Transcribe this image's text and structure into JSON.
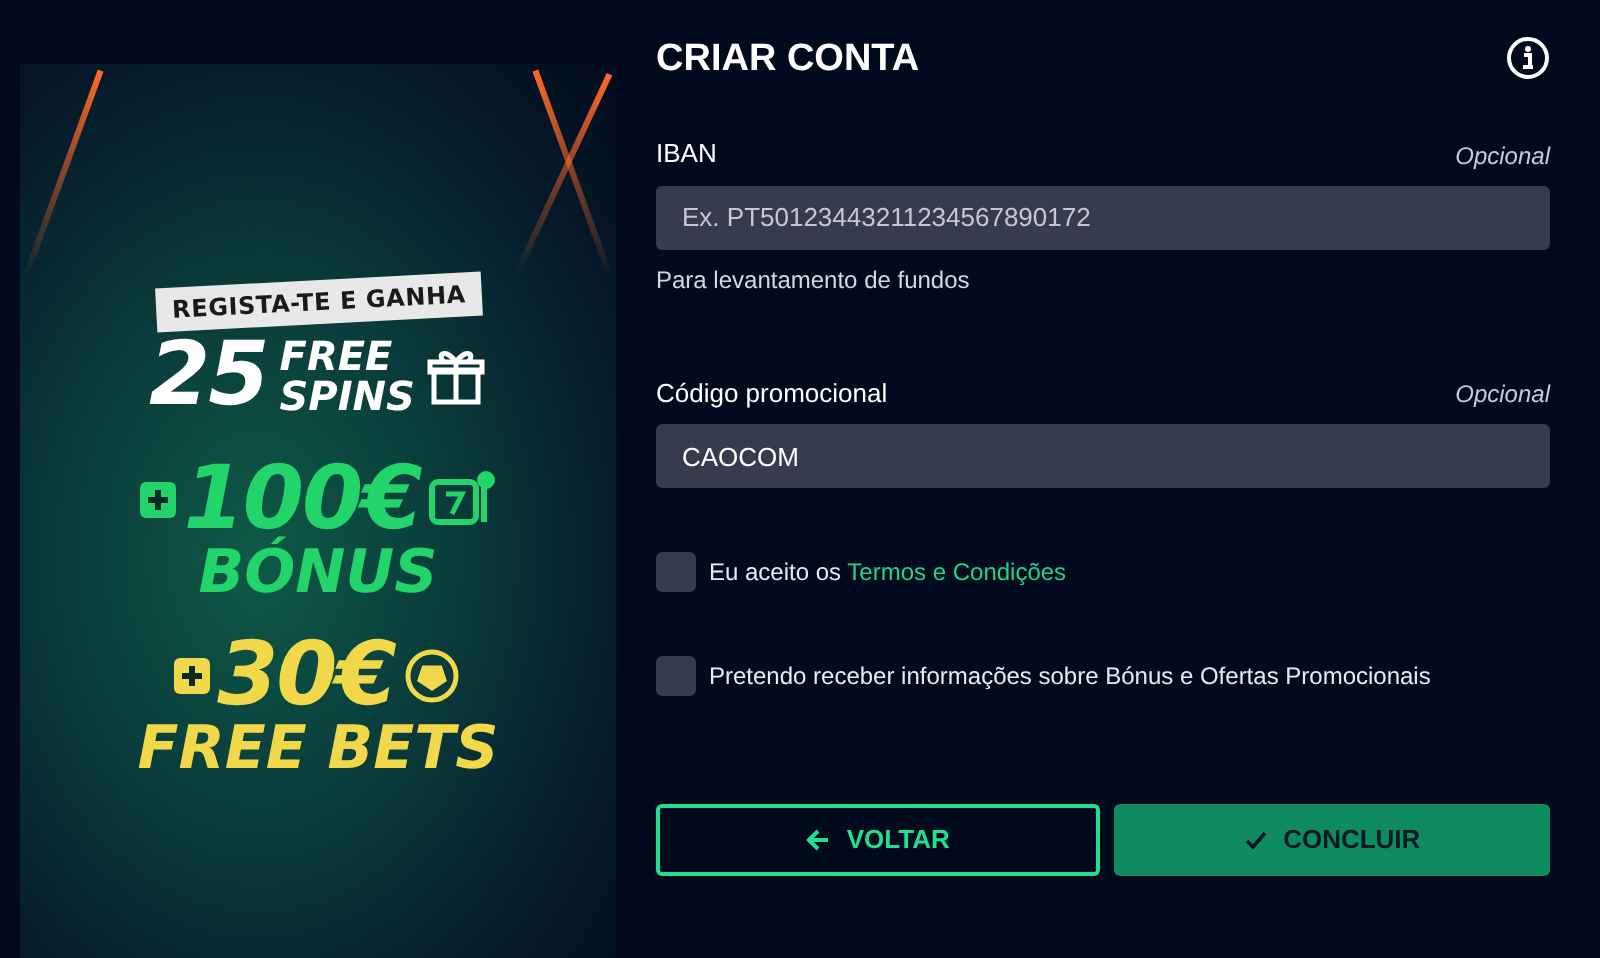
{
  "promo_banner": {
    "tagline": "REGISTA-TE E GANHA",
    "spins": {
      "amount": "25",
      "line_1": "FREE",
      "line_2": "SPINS"
    },
    "bonus": {
      "amount": "100€",
      "label": "BÓNUS"
    },
    "free_bets": {
      "amount": "30€",
      "label": "FREE BETS"
    }
  },
  "form": {
    "title": "CRIAR CONTA",
    "fields": [
      {
        "label": "IBAN",
        "optional": "Opcional",
        "placeholder": "Ex. PT50123443211234567890172",
        "help": "Para levantamento de fundos"
      },
      {
        "label": "Código promocional",
        "optional": "Opcional",
        "value": "CAOCOM"
      }
    ],
    "checkboxes": [
      {
        "text": "Eu aceito os",
        "link": "Termos e Condições",
        "checked": false
      },
      {
        "text": "Pretendo receber informações sobre Bónus e Ofertas Promocionais",
        "checked": false
      }
    ],
    "buttons": [
      {
        "kind": "back",
        "label": "VOLTAR"
      },
      {
        "kind": "submit",
        "label": "CONCLUIR"
      }
    ]
  }
}
